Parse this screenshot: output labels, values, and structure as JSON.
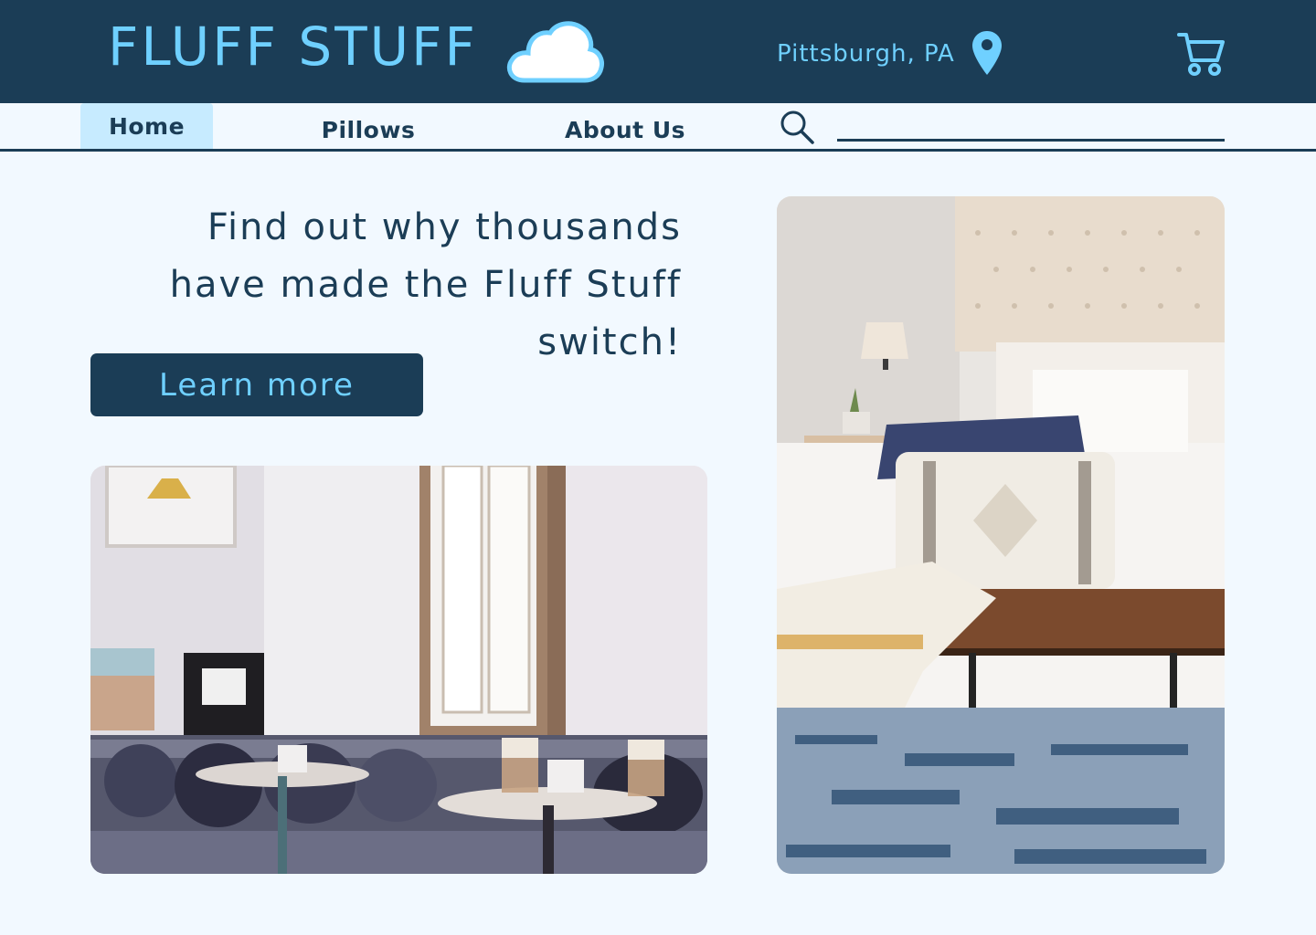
{
  "header": {
    "brand": "FLUFF STUFF",
    "location": "Pittsburgh, PA",
    "icons": [
      "cloud-icon",
      "location-pin-icon",
      "cart-icon"
    ]
  },
  "nav": {
    "items": [
      {
        "label": "Home",
        "active": true
      },
      {
        "label": "Pillows",
        "active": false
      },
      {
        "label": "About Us",
        "active": false
      }
    ],
    "search": {
      "value": "",
      "placeholder": ""
    }
  },
  "hero": {
    "headline": "Find out why thousands have made the Fluff Stuff switch!",
    "cta_label": "Learn more"
  },
  "images": [
    {
      "name": "living-room-photo"
    },
    {
      "name": "bedroom-photo"
    }
  ],
  "colors": {
    "primary": "#1b3d56",
    "accent": "#6fd0ff",
    "active_tab": "#c7ebff",
    "background": "#f2f9ff"
  }
}
